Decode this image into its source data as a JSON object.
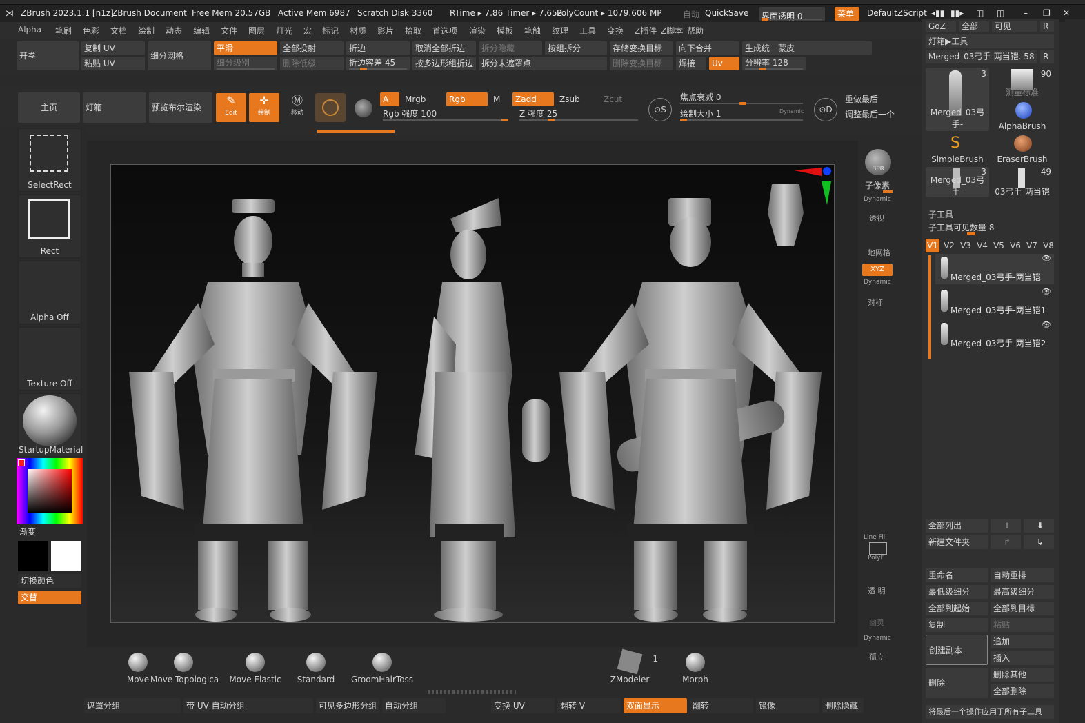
{
  "titlebar": {
    "app": "ZBrush 2023.1.1 [n1z]",
    "doc": "ZBrush Document",
    "free_mem": "Free Mem 20.57GB",
    "active_mem": "Active Mem 6987",
    "scratch": "Scratch Disk 3360",
    "rtime": "RTime ▸ 7.86 Timer ▸ 7.652",
    "polycount": "PolyCount ▸ 1079.606 MP",
    "auto": "自动",
    "quicksave": "QuickSave",
    "transparency": "界面透明 0",
    "menu_btn": "菜单",
    "script": "DefaultZScript"
  },
  "menubar": [
    "Alpha",
    "笔刷",
    "色彩",
    "文档",
    "绘制",
    "动态",
    "编辑",
    "文件",
    "图层",
    "灯光",
    "宏",
    "标记",
    "材质",
    "影片",
    "拾取",
    "首选项",
    "渲染",
    "模板",
    "笔触",
    "纹理",
    "工具",
    "变换",
    "Z插件",
    "Z脚本",
    "帮助"
  ],
  "geometry": {
    "kaijuan": "开卷",
    "copy_uv": "复制 UV",
    "paste_uv": "粘贴 UV",
    "subdiv_mesh": "细分网格",
    "smooth": "平滑",
    "subdiv_level": "细分级别",
    "full_project": "全部投射",
    "del_lower": "删除低级",
    "crease": "折边",
    "crease_tol": "折边容差 45",
    "uncrease_all": "取消全部折边",
    "split_by_poly": "按多边形组折边",
    "split_hidden": "拆分隐藏",
    "split_unmasked": "拆分未遮罩点",
    "groups_split": "按组拆分",
    "store_morph": "存储变换目标",
    "del_morph": "删除变换目标",
    "merge_down": "向下合并",
    "weld": "焊接",
    "uv": "Uv",
    "unify_skin": "生成统一蒙皮",
    "resolution": "分辨率 128"
  },
  "toolbar": {
    "home": "主页",
    "lightbox": "灯箱",
    "preview_bool": "预览布尔渲染",
    "edit": "Edit",
    "draw": "绘制",
    "move": "移动",
    "a": "A",
    "mrgb": "Mrgb",
    "rgb": "Rgb",
    "m": "M",
    "zadd": "Zadd",
    "zsub": "Zsub",
    "zcut": "Zcut",
    "rgb_intensity": "Rgb 强度 100",
    "z_intensity": "Z 强度 25",
    "rgb_intensity_value": 100,
    "z_intensity_value": 25,
    "focal_shift": "焦点衰减 0",
    "draw_size": "绘制大小 1",
    "dynamic": "Dynamic",
    "replay_last": "重做最后",
    "replay_adjust": "调整最后一个"
  },
  "left_shelf": {
    "select_rect": "SelectRect",
    "rect": "Rect",
    "alpha_off": "Alpha Off",
    "texture_off": "Texture Off",
    "material": "StartupMaterial",
    "gradient": "渐变",
    "switch_color": "切换颜色",
    "alternate": "交替",
    "main_color": "#ff1a1a"
  },
  "right_strip": {
    "bpr": "BPR",
    "subpixel": "子像素",
    "dynamic1": "Dynamic",
    "persp": "透视",
    "floor": "地网格",
    "xyz": "XYZ",
    "dynamic2": "Dynamic",
    "symmetry": "对称",
    "line_fill": "Line Fill",
    "polyf": "PolyF",
    "transp": "透 明",
    "ghost": "幽灵",
    "dynamic3": "Dynamic",
    "solo": "孤立"
  },
  "brushes": {
    "left": [
      "Move",
      "Move Topologica",
      "Move Elastic",
      "Standard",
      "GroomHairToss"
    ],
    "zmodeler": "ZModeler",
    "zmodeler_count": "1",
    "morph": "Morph"
  },
  "bottombar": {
    "mask_group": "遮罩分组",
    "uv_autogroup": "带 UV 自动分组",
    "visible_poly": "可见多边形分组",
    "auto_group": "自动分组",
    "morph_uv": "变换 UV",
    "flip_v": "翻转 V",
    "double": "双面显示",
    "flip": "翻转",
    "mirror": "镜像",
    "del_hidden": "删除隐藏"
  },
  "right_panel": {
    "goz": "GoZ",
    "all": "全部",
    "visible": "可见",
    "r": "R",
    "lightbox_tools": "灯箱▶工具",
    "current_tool": "Merged_03弓手-两当铠. 58",
    "tools": [
      {
        "name": "Merged_03弓手-",
        "count": "3"
      },
      {
        "name": "测量标准",
        "count": "90"
      },
      {
        "name": "AlphaBrush",
        "count": ""
      },
      {
        "name": "SimpleBrush",
        "count": ""
      },
      {
        "name": "EraserBrush",
        "count": ""
      },
      {
        "name": "Merged_03弓手-",
        "count": "3"
      },
      {
        "name": "03弓手-两当铠",
        "count": "49"
      }
    ],
    "subtool_title": "子工具",
    "subtool_visible": "子工具可见数量 8",
    "versions": [
      "V1",
      "V2",
      "V3",
      "V4",
      "V5",
      "V6",
      "V7",
      "V8"
    ],
    "subtools": [
      "Merged_03弓手-两当铠",
      "Merged_03弓手-两当铠1",
      "Merged_03弓手-两当铠2"
    ],
    "list_all": "全部列出",
    "new_folder": "新建文件夹",
    "rename": "重命名",
    "auto_reorder": "自动重排",
    "lowest_sub": "最低级细分",
    "highest_sub": "最高级细分",
    "all_to_start": "全部到起始",
    "all_to_target": "全部到目标",
    "copy": "复制",
    "paste": "粘贴",
    "duplicate": "创建副本",
    "append": "追加",
    "insert": "插入",
    "delete": "删除",
    "del_other": "删除其他",
    "del_all": "全部删除",
    "footer_note": "将最后一个操作应用于所有子工具"
  }
}
